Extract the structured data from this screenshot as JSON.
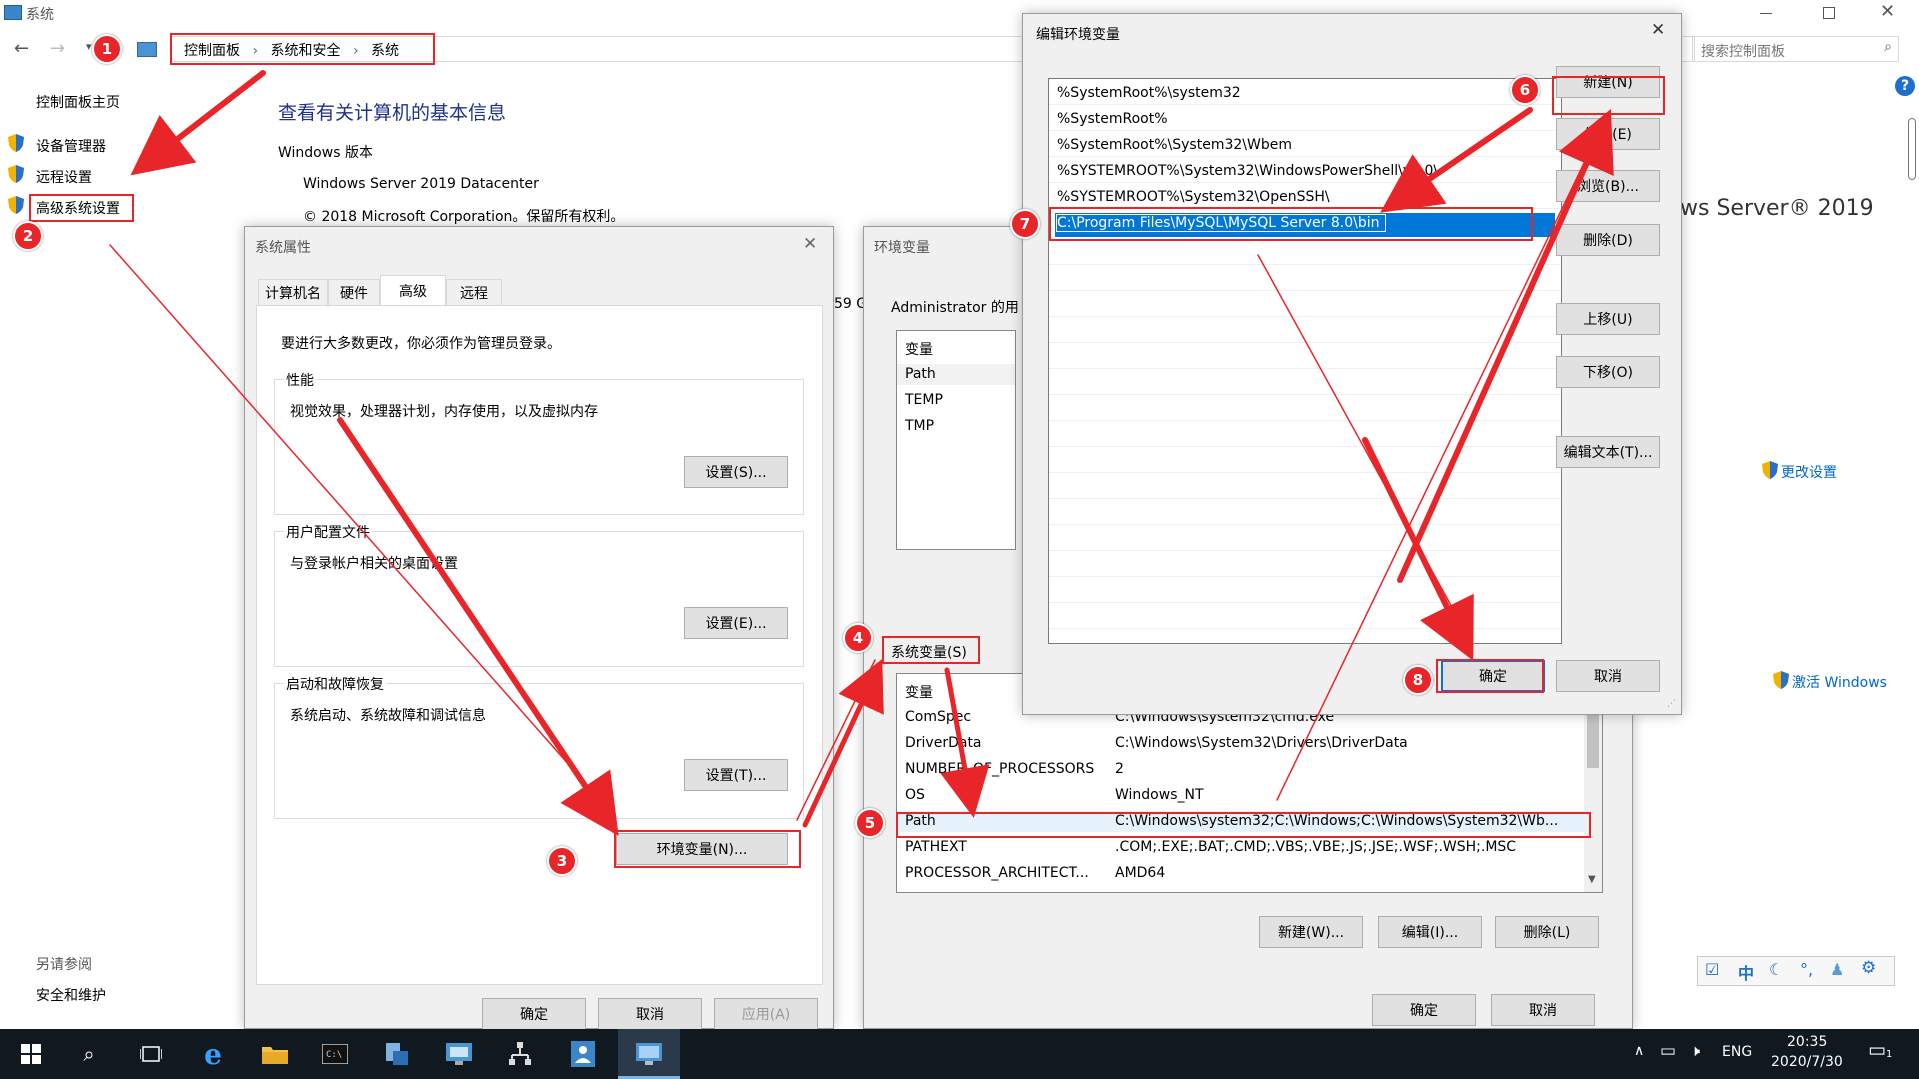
{
  "window": {
    "title": "系统",
    "breadcrumb": [
      "控制面板",
      "系统和安全",
      "系统"
    ],
    "search_placeholder": "搜索控制面板"
  },
  "left_nav": {
    "home": "控制面板主页",
    "items": [
      "设备管理器",
      "远程设置",
      "高级系统设置"
    ],
    "see_also_title": "另请参阅",
    "see_also_item": "安全和维护"
  },
  "main": {
    "heading": "查看有关计算机的基本信息",
    "edition_label": "Windows 版本",
    "edition": "Windows Server 2019 Datacenter",
    "copyright": "© 2018 Microsoft Corporation。保留所有权利。",
    "brand_partial": "ws Server® 2019",
    "fragment_59": "59 G",
    "change_settings": "更改设置",
    "activate": "激活 Windows"
  },
  "sysprops": {
    "title": "系统属性",
    "tabs": [
      "计算机名",
      "硬件",
      "高级",
      "远程"
    ],
    "admin_note": "要进行大多数更改，你必须作为管理员登录。",
    "perf_title": "性能",
    "perf_desc": "视觉效果，处理器计划，内存使用，以及虚拟内存",
    "perf_btn": "设置(S)...",
    "profile_title": "用户配置文件",
    "profile_desc": "与登录帐户相关的桌面设置",
    "profile_btn": "设置(E)...",
    "startup_title": "启动和故障恢复",
    "startup_desc": "系统启动、系统故障和调试信息",
    "startup_btn": "设置(T)...",
    "env_btn": "环境变量(N)...",
    "ok": "确定",
    "cancel": "取消",
    "apply": "应用(A)"
  },
  "envvars": {
    "title": "环境变量",
    "user_section": "Administrator 的用",
    "user_col": "变量",
    "user_vars": [
      "Path",
      "TEMP",
      "TMP"
    ],
    "system_section": "系统变量(S)",
    "sys_col": "变量",
    "sys_vars": [
      {
        "name": "ComSpec",
        "value": "C:\\Windows\\system32\\cmd.exe"
      },
      {
        "name": "DriverData",
        "value": "C:\\Windows\\System32\\Drivers\\DriverData"
      },
      {
        "name": "NUMBER_OF_PROCESSORS",
        "value": "2"
      },
      {
        "name": "OS",
        "value": "Windows_NT"
      },
      {
        "name": "Path",
        "value": "C:\\Windows\\system32;C:\\Windows;C:\\Windows\\System32\\Wb..."
      },
      {
        "name": "PATHEXT",
        "value": ".COM;.EXE;.BAT;.CMD;.VBS;.VBE;.JS;.JSE;.WSF;.WSH;.MSC"
      },
      {
        "name": "PROCESSOR_ARCHITECT...",
        "value": "AMD64"
      }
    ],
    "new_btn": "新建(W)...",
    "edit_btn": "编辑(I)...",
    "delete_btn": "删除(L)",
    "ok": "确定",
    "cancel": "取消"
  },
  "editenv": {
    "title": "编辑环境变量",
    "entries": [
      "%SystemRoot%\\system32",
      "%SystemRoot%",
      "%SystemRoot%\\System32\\Wbem",
      "%SYSTEMROOT%\\System32\\WindowsPowerShell\\v1.0\\",
      "%SYSTEMROOT%\\System32\\OpenSSH\\",
      "C:\\Program Files\\MySQL\\MySQL Server 8.0\\bin"
    ],
    "buttons": [
      "新建(N)",
      "编辑(E)",
      "浏览(B)...",
      "删除(D)",
      "上移(U)",
      "下移(O)",
      "编辑文本(T)..."
    ],
    "ok": "确定",
    "cancel": "取消"
  },
  "annotations": {
    "badges": [
      "1",
      "2",
      "3",
      "4",
      "5",
      "6",
      "7",
      "8"
    ],
    "accent_color": "#e8262a"
  },
  "taskbar": {
    "lang": "ENG",
    "ime": "中",
    "time": "20:35",
    "date": "2020/7/30",
    "notifications": "1"
  },
  "colors": {
    "selection": "#0078d7",
    "link": "#0066cc",
    "taskbar": "#101820"
  }
}
